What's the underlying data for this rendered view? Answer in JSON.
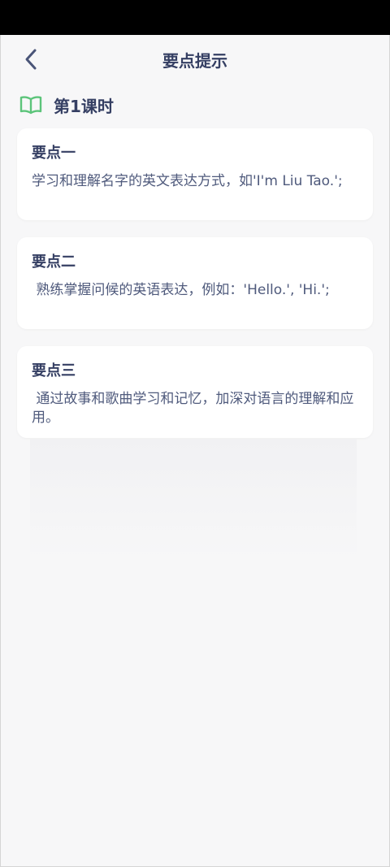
{
  "header": {
    "title": "要点提示",
    "back_icon": "chevron-left-icon"
  },
  "lesson": {
    "icon": "open-book-icon",
    "icon_color": "#5cc47a",
    "title": "第1课时"
  },
  "points": [
    {
      "title": "要点一",
      "body": "学习和理解名字的英文表达方式，如'I'm Liu Tao.';"
    },
    {
      "title": "要点二",
      "body": " 熟练掌握问候的英语表达，例如：'Hello.', 'Hi.';"
    },
    {
      "title": "要点三",
      "body": " 通过故事和歌曲学习和记忆，加深对语言的理解和应用。"
    }
  ],
  "colors": {
    "text_primary": "#353f63",
    "text_body": "#4f5a7c",
    "background": "#f7f7f8",
    "card": "#ffffff"
  }
}
